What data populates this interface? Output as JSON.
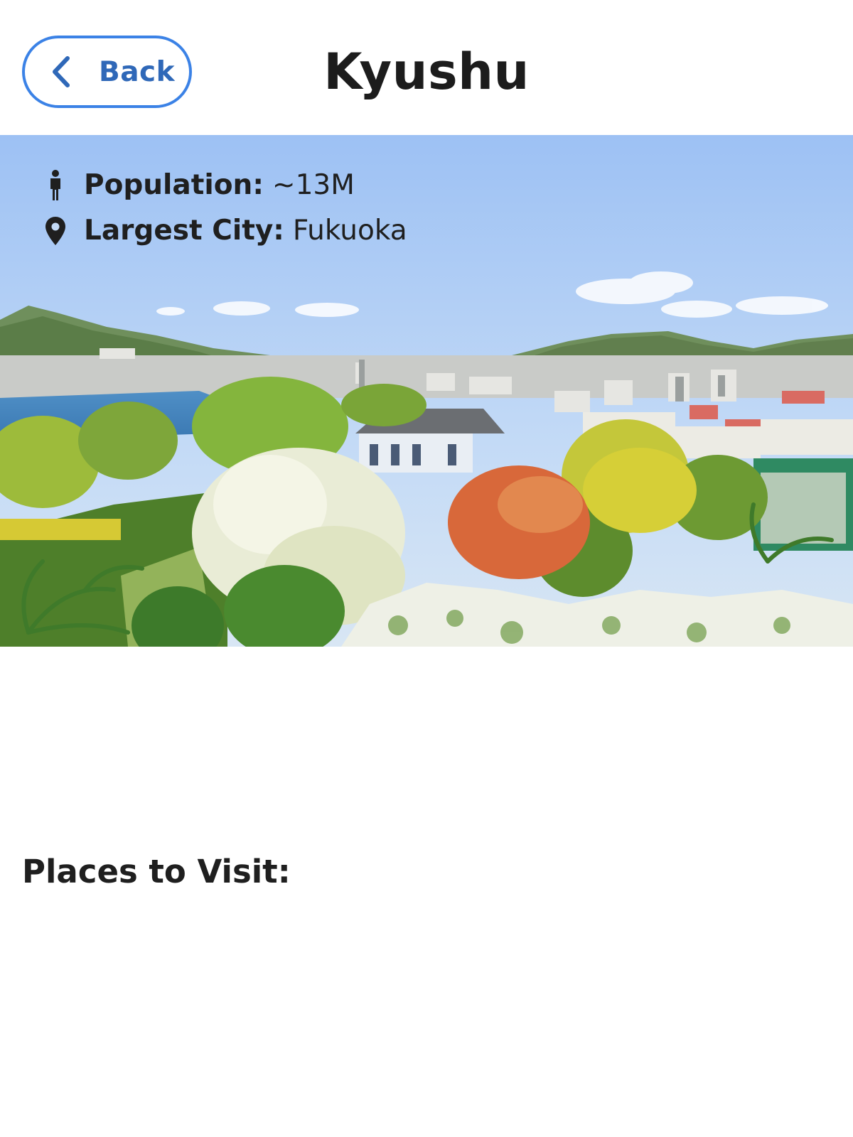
{
  "header": {
    "back_label": "Back",
    "title": "Kyushu"
  },
  "hero": {
    "population_label": "Population:",
    "population_value": "~13M",
    "population_icon": "person-icon",
    "city_label": "Largest City:",
    "city_value": "Fukuoka",
    "city_icon": "location-pin-icon"
  },
  "places": {
    "title": "Places to Visit:"
  },
  "colors": {
    "accent": "#3b82e6",
    "back_text": "#2f68b8",
    "text": "#1f1f1f"
  }
}
